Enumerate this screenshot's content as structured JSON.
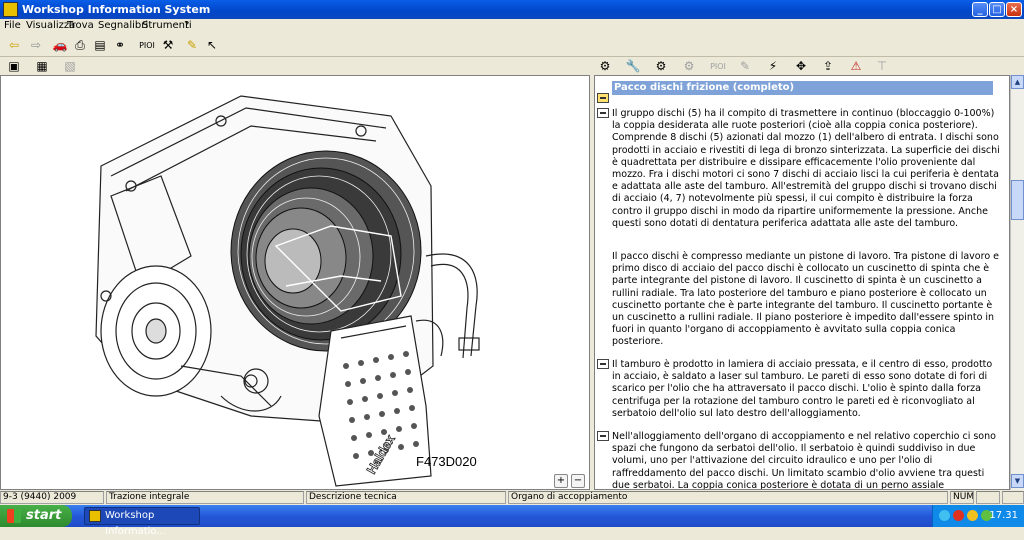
{
  "window": {
    "title": "Workshop Information System"
  },
  "menu": [
    "File",
    "Visualizza",
    "Trova",
    "Segnalibri",
    "Strumenti",
    "?"
  ],
  "toolbar": {
    "pioi_label": "PIOI",
    "pioi_label_2": "PIOI"
  },
  "figure": {
    "label": "F473D020",
    "brand": "Haldex"
  },
  "document": {
    "heading": "Pacco dischi frizione (completo)",
    "paragraphs": [
      "Il gruppo dischi (5) ha il compito di trasmettere in continuo (bloccaggio 0-100%) la coppia desiderata alle ruote posteriori (cioè alla coppia conica posteriore). Comprende 8 dischi (5) azionati dal mozzo (1) dell'albero di entrata. I dischi sono prodotti in acciaio e rivestiti di lega di bronzo sinterizzata. La superficie dei dischi è quadrettata per distribuire e dissipare efficacemente l'olio proveniente dal mozzo. Fra i dischi motori ci sono 7 dischi di acciaio lisci la cui periferia è dentata e adattata alle aste del tamburo. All'estremità del gruppo dischi si trovano dischi di acciaio (4, 7) notevolmente più spessi, il cui compito è distribuire la forza contro il gruppo dischi in modo da ripartire uniformemente la pressione. Anche questi sono dotati di dentatura periferica adattata alle aste del tamburo.",
      "Il pacco dischi è compresso mediante un pistone di lavoro. Tra pistone di lavoro e primo disco di acciaio del pacco dischi è collocato un cuscinetto di spinta che è parte integrante del pistone di lavoro. Il cuscinetto di spinta è un cuscinetto a rullini radiale. Tra lato posteriore del tamburo e piano posteriore è collocato un cuscinetto portante che è parte integrante del tamburo. Il cuscinetto portante è un cuscinetto a rullini radiale. Il piano posteriore è impedito dall'essere spinto in fuori in quanto l'organo di accoppiamento è avvitato sulla coppia conica posteriore.",
      "Il tamburo è prodotto in lamiera di acciaio pressata, e il centro di esso, prodotto in acciaio, è saldato a laser sul tamburo. Le pareti di esso sono dotate di fori di scarico per l'olio che ha attraversato il pacco dischi. L'olio è spinto dalla forza centrifuga per la rotazione del tamburo contro le pareti ed è riconvogliato al serbatoio dell'olio sul lato destro dell'alloggiamento.",
      "Nell'alloggiamento dell'organo di accoppiamento e nel relativo coperchio ci sono spazi che fungono da serbatoi dell'olio. Il serbatoio è quindi suddiviso in due volumi, uno per l'attivazione del circuito idraulico e uno per l'olio di raffreddamento del pacco dischi. Un limitato scambio d'olio avviene tra questi due serbatoi. La coppia conica posteriore è dotata di un perno assiale"
    ]
  },
  "status": {
    "vehicle": "9-3 (9440) 2009",
    "system": "Trazione integrale",
    "doc_type": "Descrizione tecnica",
    "component": "Organo di accoppiamento",
    "num": "NUM"
  },
  "taskbar": {
    "start": "start",
    "task": "Workshop Informatio...",
    "clock": "17.31"
  },
  "colors": {
    "heading_bg": "#7fa3d8",
    "titlebar": "#0a5ee8",
    "taskbar": "#2458d8"
  }
}
